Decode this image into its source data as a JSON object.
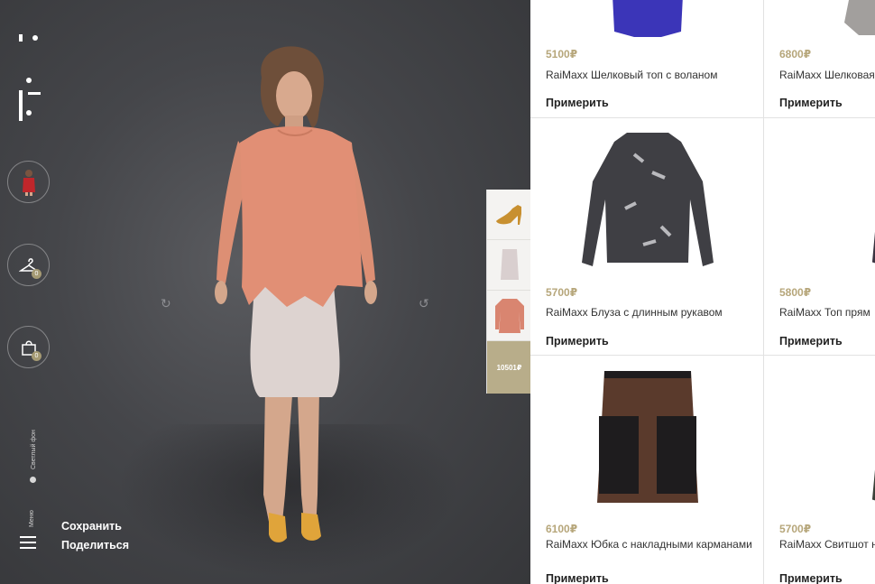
{
  "sidebar": {
    "bg_toggle_label": "Светлый фон",
    "menu_label": "Меню",
    "wardrobe_badge": "0",
    "cart_badge": "0",
    "save_label": "Сохранить",
    "share_label": "Поделиться"
  },
  "outfit": {
    "items": [
      "shoes",
      "skirt",
      "blouse"
    ],
    "total": "10501₽"
  },
  "catalog": {
    "products": [
      {
        "price": "5100₽",
        "title": "RaiMaxx Шелковый топ с воланом",
        "action": "Примерить",
        "color": "#3b35b8"
      },
      {
        "price": "6800₽",
        "title": "RaiMaxx Шелковая",
        "action": "Примерить",
        "color": "#7a7674"
      },
      {
        "price": "5700₽",
        "title": "RaiMaxx Блуза с длинным рукавом",
        "action": "Примерить",
        "color": "#3f3f44"
      },
      {
        "price": "5800₽",
        "title": "RaiMaxx Топ прям",
        "action": "Примерить",
        "color": "#3a3340"
      },
      {
        "price": "6100₽",
        "title": "RaiMaxx Юбка с накладными карманами",
        "action": "Примерить",
        "color": "#5a3a2c"
      },
      {
        "price": "5700₽",
        "title": "RaiMaxx Свитшот низом",
        "action": "Примерить",
        "color": "#3b4038"
      }
    ]
  }
}
